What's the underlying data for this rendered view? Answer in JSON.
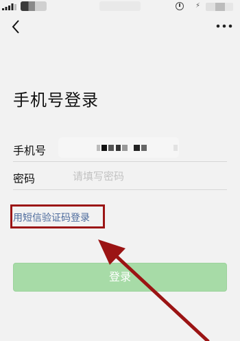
{
  "status_bar": {
    "signal_icon": "signal-bars-icon",
    "misc_icon": "alarm-icon",
    "charge_icon": "charging-bolt-icon"
  },
  "nav": {
    "back_icon": "chevron-left-icon",
    "more_icon": "more-dots-icon"
  },
  "title": "手机号登录",
  "form": {
    "phone_label": "手机号",
    "password_label": "密码",
    "password_placeholder": "请填写密码"
  },
  "sms_login_link": "用短信验证码登录",
  "login_button": "登录",
  "colors": {
    "background": "#f2f2f2",
    "link": "#4c6a9c",
    "button_disabled": "#a7dba7",
    "annotation": "#9b1414"
  }
}
